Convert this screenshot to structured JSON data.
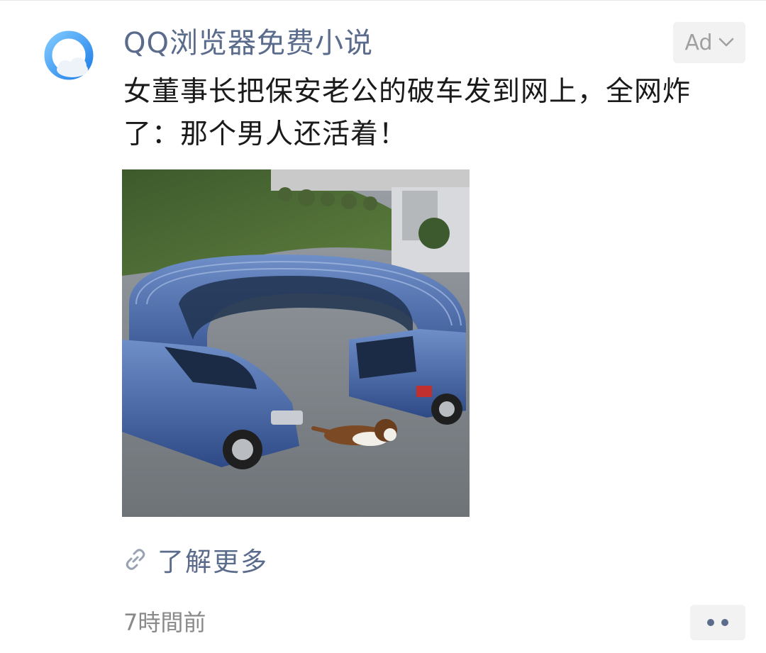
{
  "account": {
    "name": "QQ浏览器免费小说",
    "avatar_icon": "qq-browser-logo-icon",
    "brand_colors": {
      "ring": "#2f8ff0",
      "ring_light": "#7ec8ff",
      "cloud": "#eef3f9"
    }
  },
  "ad_tag": {
    "label": "Ad",
    "icon": "chevron-down-icon"
  },
  "post": {
    "headline": "女董事长把保安老公的破车发到网上，全网炸了：那个男人还活着！",
    "image_icon": "curved-car-photo",
    "learn_more": {
      "label": "了解更多",
      "icon": "link-icon"
    },
    "timestamp": "7時間前"
  },
  "more_button": {
    "icon": "more-dots-icon"
  },
  "colors": {
    "link_blue_gray": "#5a6b8c",
    "text_primary": "#1a1a1a",
    "text_secondary": "#8a8a8a",
    "chip_bg": "#f2f2f2"
  }
}
